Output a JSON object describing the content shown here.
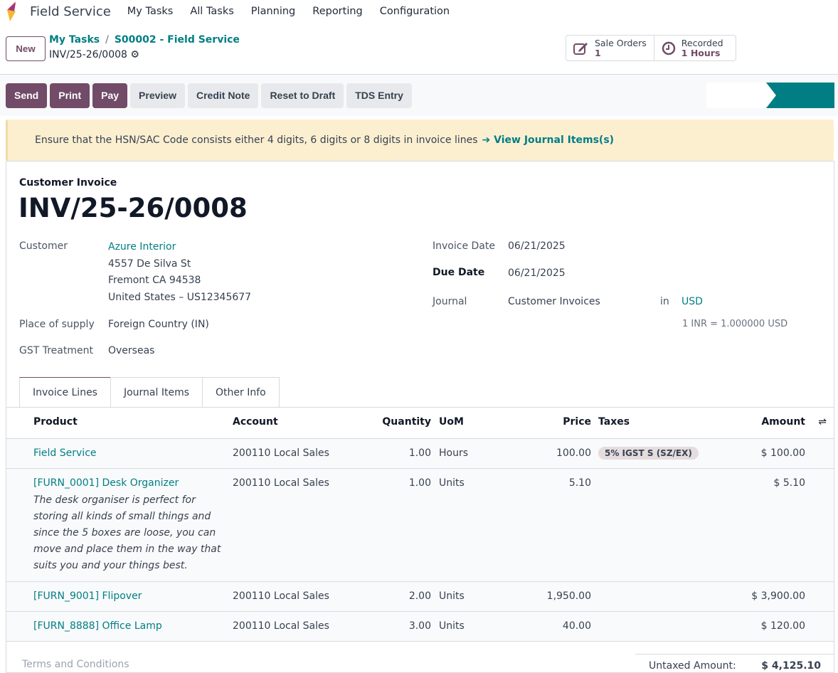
{
  "nav": {
    "app": "Field Service",
    "menu": [
      "My Tasks",
      "All Tasks",
      "Planning",
      "Reporting",
      "Configuration"
    ]
  },
  "control": {
    "new": "New",
    "breadcrumb": [
      "My Tasks",
      "S00002 - Field Service"
    ],
    "record": "INV/25-26/0008",
    "stats": [
      {
        "label": "Sale Orders",
        "value": "1"
      },
      {
        "label": "Recorded",
        "value": "1 Hours"
      }
    ]
  },
  "actions": {
    "primary": [
      "Send",
      "Print",
      "Pay"
    ],
    "secondary": [
      "Preview",
      "Credit Note",
      "Reset to Draft",
      "TDS Entry"
    ]
  },
  "alert": {
    "text": "Ensure that the HSN/SAC Code consists either 4 digits, 6 digits or 8 digits in invoice lines",
    "link": "➔ View Journal Items(s)"
  },
  "invoice": {
    "type": "Customer Invoice",
    "number": "INV/25-26/0008",
    "customer_label": "Customer",
    "customer": "Azure Interior",
    "address": [
      "4557 De Silva St",
      "Fremont CA 94538",
      "United States – US12345677"
    ],
    "place_label": "Place of supply",
    "place": "Foreign Country (IN)",
    "gst_label": "GST Treatment",
    "gst": "Overseas",
    "date_label": "Invoice Date",
    "date": "06/21/2025",
    "due_label": "Due Date",
    "due": "06/21/2025",
    "journal_label": "Journal",
    "journal": "Customer Invoices",
    "in": "in",
    "currency": "USD",
    "rate": "1 INR = 1.000000 USD"
  },
  "tabs": [
    "Invoice Lines",
    "Journal Items",
    "Other Info"
  ],
  "table": {
    "headers": [
      "Product",
      "Account",
      "Quantity",
      "UoM",
      "Price",
      "Taxes",
      "Amount"
    ],
    "rows": [
      {
        "product": "Field Service",
        "account": "200110 Local Sales",
        "qty": "1.00",
        "uom": "Hours",
        "price": "100.00",
        "tax": "5% IGST S (SZ/EX)",
        "amount": "$ 100.00"
      },
      {
        "product": "[FURN_0001] Desk Organizer",
        "desc": "The desk organiser is perfect for storing all kinds of small things and since the 5 boxes are loose, you can move and place them in the way that suits you and your things best.",
        "account": "200110 Local Sales",
        "qty": "1.00",
        "uom": "Units",
        "price": "5.10",
        "tax": "",
        "amount": "$ 5.10"
      },
      {
        "product": "[FURN_9001] Flipover",
        "account": "200110 Local Sales",
        "qty": "2.00",
        "uom": "Units",
        "price": "1,950.00",
        "tax": "",
        "amount": "$ 3,900.00"
      },
      {
        "product": "[FURN_8888] Office Lamp",
        "account": "200110 Local Sales",
        "qty": "3.00",
        "uom": "Units",
        "price": "40.00",
        "tax": "",
        "amount": "$ 120.00"
      }
    ]
  },
  "footer": {
    "terms": "Terms and Conditions",
    "untaxed_label": "Untaxed Amount:",
    "untaxed": "$ 4,125.10"
  }
}
